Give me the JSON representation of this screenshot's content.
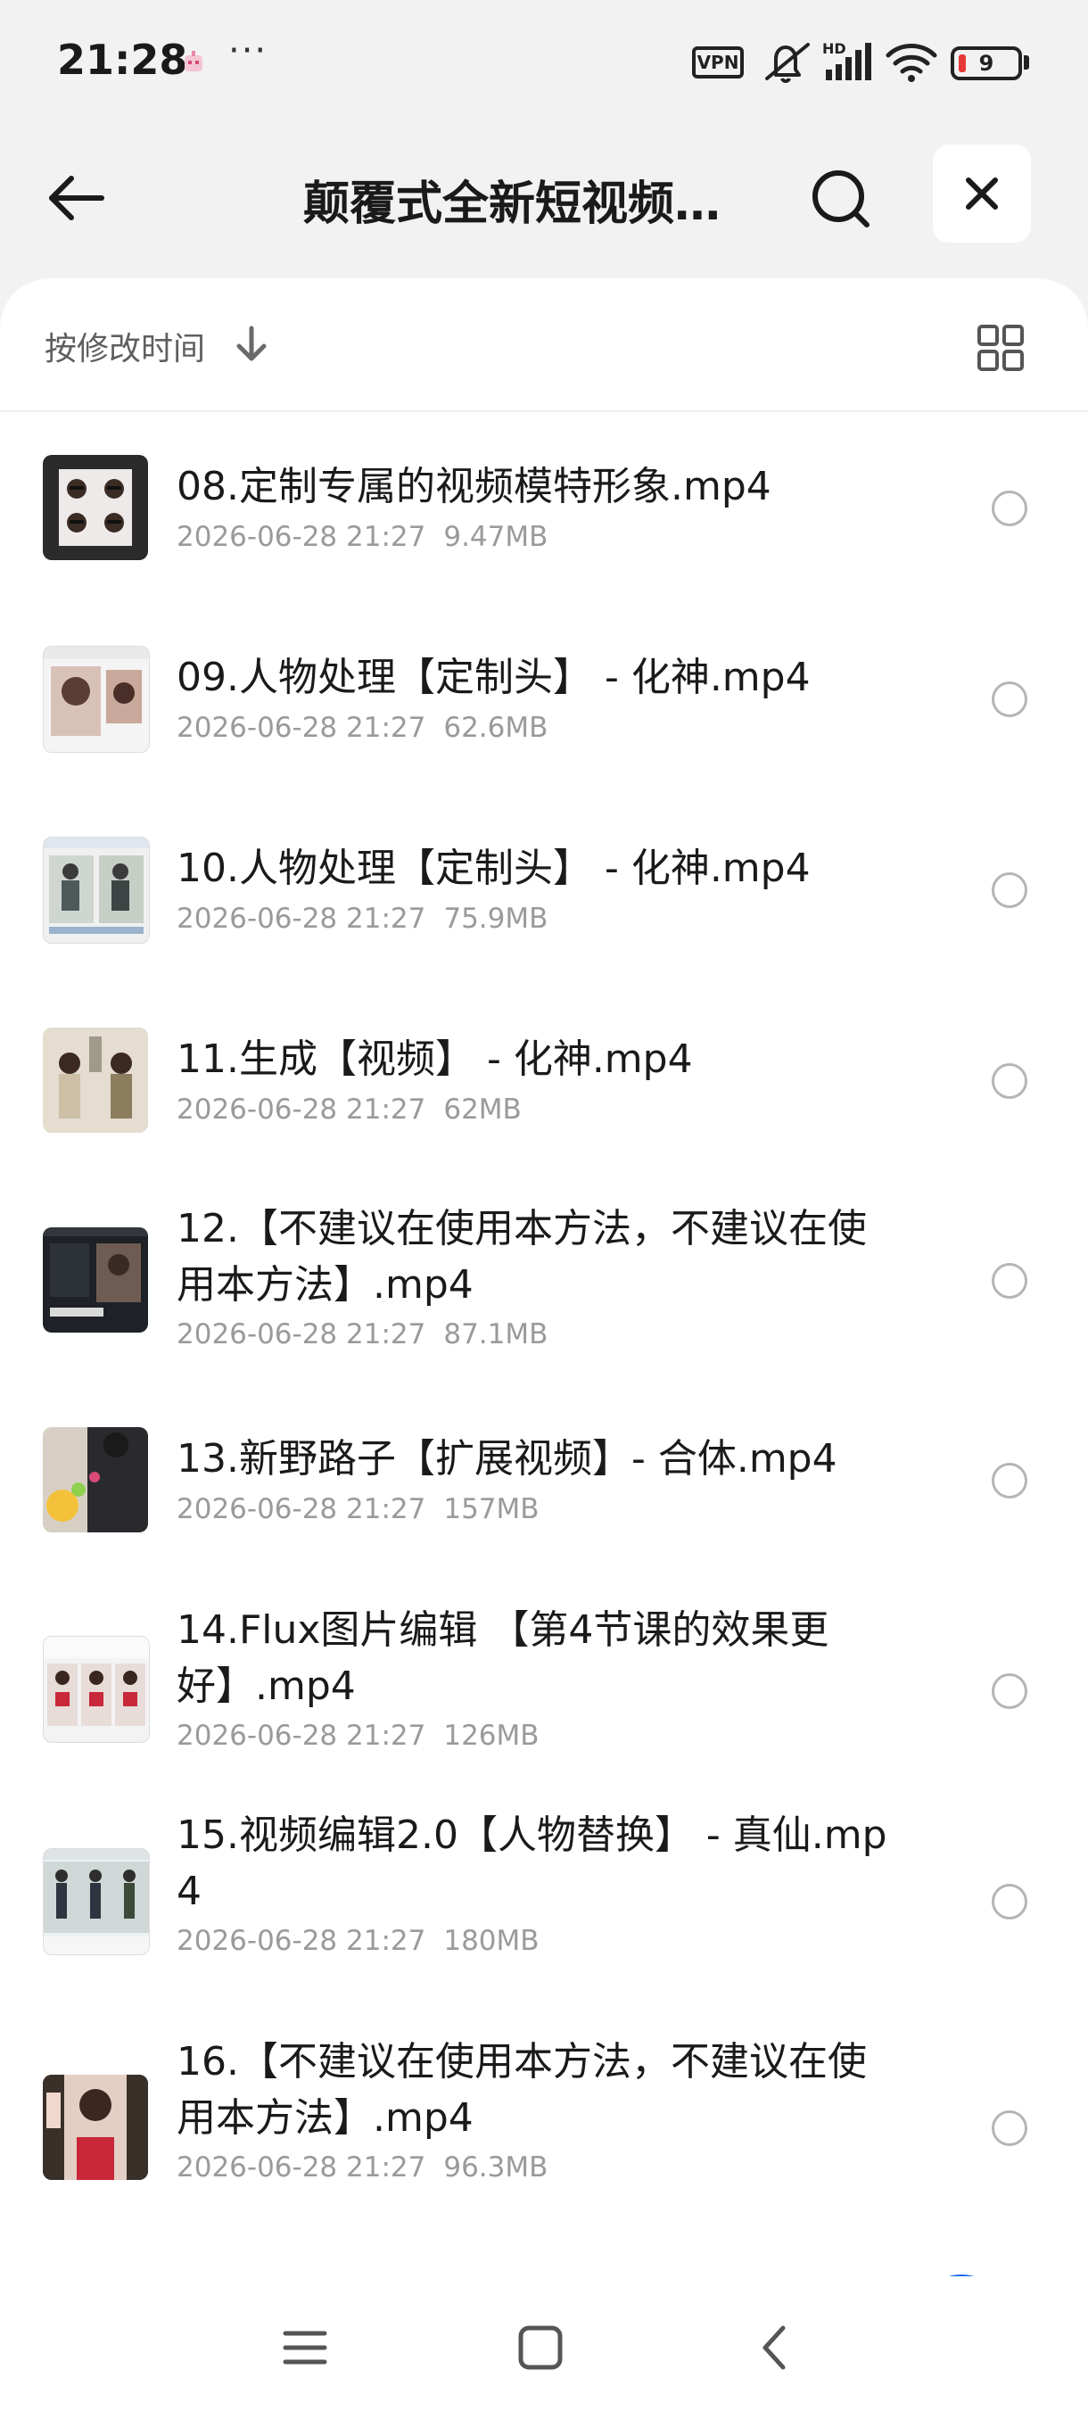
{
  "status_bar": {
    "time": "21:28",
    "more": "···",
    "vpn": "VPN",
    "hd": "HD",
    "battery": "9",
    "icons": [
      "app-notification-icon",
      "mute-icon",
      "signal-icon",
      "wifi-icon",
      "battery-icon"
    ]
  },
  "header": {
    "title": "颠覆式全新短视频…",
    "icons": [
      "back-arrow-icon",
      "search-icon",
      "close-icon"
    ]
  },
  "sort": {
    "label": "按修改时间",
    "icons": [
      "arrow-down-icon",
      "grid-view-icon"
    ]
  },
  "files": [
    {
      "name": "08.定制专属的视频模特形象.mp4",
      "date": "2026-06-28 21:27",
      "size": "9.47MB"
    },
    {
      "name": "09.人物处理【定制头】 - 化神.mp4",
      "date": "2026-06-28 21:27",
      "size": "62.6MB"
    },
    {
      "name": "10.人物处理【定制头】 - 化神.mp4",
      "date": "2026-06-28 21:27",
      "size": "75.9MB"
    },
    {
      "name": "11.生成【视频】 - 化神.mp4",
      "date": "2026-06-28 21:27",
      "size": "62MB"
    },
    {
      "name": "12.【不建议在使用本方法，不建议在使用本方法】.mp4",
      "date": "2026-06-28 21:27",
      "size": "87.1MB"
    },
    {
      "name": "13.新野路子【扩展视频】- 合体.mp4",
      "date": "2026-06-28 21:27",
      "size": "157MB"
    },
    {
      "name": "14.Flux图片编辑 【第4节课的效果更好】.mp4",
      "date": "2026-06-28 21:27",
      "size": "126MB"
    },
    {
      "name": "15.视频编辑2.0【人物替换】 - 真仙.mp4",
      "date": "2026-06-28 21:27",
      "size": "180MB"
    },
    {
      "name": "16.【不建议在使用本方法，不建议在使用本方法】.mp4",
      "date": "2026-06-28 21:27",
      "size": "96.3MB"
    }
  ],
  "nav_bar": {
    "icons": [
      "menu-icon",
      "home-icon",
      "back-icon"
    ]
  },
  "colors": {
    "background": "#f2f2f2",
    "card": "#ffffff",
    "text": "#1a1a1a",
    "meta": "#9a9a9a",
    "accent": "#1766e8"
  }
}
